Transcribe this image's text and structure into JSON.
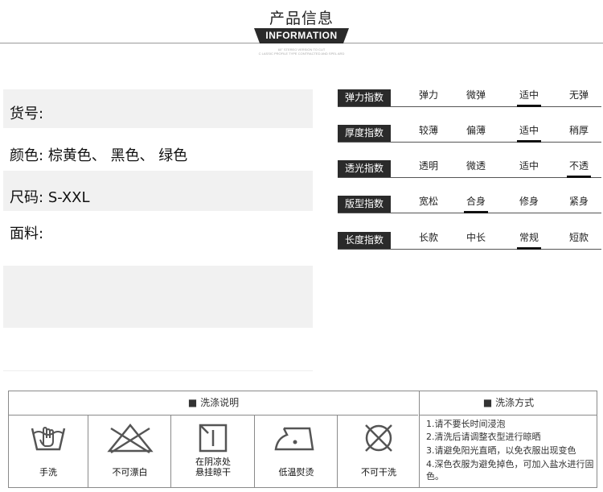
{
  "header": {
    "title": "产品信息",
    "badge": "INFORMATION",
    "subtitle_line1": "60° STEREO VERSION TO CUT",
    "subtitle_line2": "C LASSIC PROFILE TYPE CONTRACTED AND SPEL ARD"
  },
  "info": {
    "sku_label": "货号:",
    "color_label": "颜色:",
    "color_value": "棕黄色、 黑色、 绿色",
    "size_label": "尺码:",
    "size_value": "S-XXL",
    "fabric_label": "面料:"
  },
  "indices": [
    {
      "label": "弹力指数",
      "options": [
        "弹力",
        "微弹",
        "适中",
        "无弹"
      ],
      "selected": 2
    },
    {
      "label": "厚度指数",
      "options": [
        "较薄",
        "偏薄",
        "适中",
        "稍厚"
      ],
      "selected": 2
    },
    {
      "label": "透光指数",
      "options": [
        "透明",
        "微透",
        "适中",
        "不透"
      ],
      "selected": 3
    },
    {
      "label": "版型指数",
      "options": [
        "宽松",
        "合身",
        "修身",
        "紧身"
      ],
      "selected": 1
    },
    {
      "label": "长度指数",
      "options": [
        "长款",
        "中长",
        "常规",
        "短款"
      ],
      "selected": 2
    }
  ],
  "washing": {
    "left_header": "■ 洗涤说明",
    "right_header": "■ 洗涤方式",
    "symbols": [
      {
        "icon": "hand-wash-icon",
        "caption": "手洗"
      },
      {
        "icon": "no-bleach-icon",
        "caption": "不可漂白"
      },
      {
        "icon": "shade-dry-icon",
        "caption_line1": "在阴凉处",
        "caption_line2": "悬挂晾干"
      },
      {
        "icon": "low-iron-icon",
        "caption": "低温熨烫"
      },
      {
        "icon": "no-dry-clean-icon",
        "caption": "不可干洗"
      }
    ],
    "notes": [
      "1.请不要长时间浸泡",
      "2.清洗后请调整衣型进行晾晒",
      "3.请避免阳光直晒，以免衣服出现变色",
      "4.深色衣服为避免掉色，可加入盐水进行固色。"
    ]
  }
}
